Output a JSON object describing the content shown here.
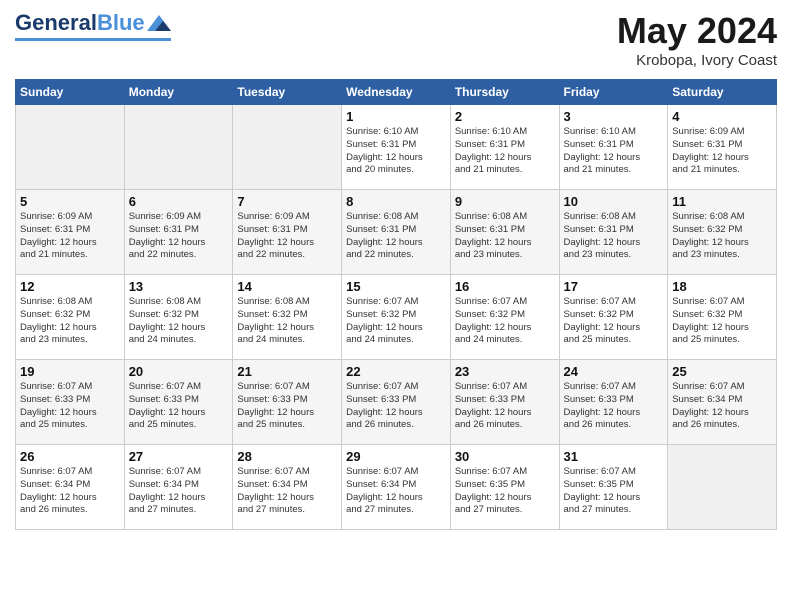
{
  "header": {
    "logo_line1": "General",
    "logo_line2": "Blue",
    "month": "May 2024",
    "location": "Krobopa, Ivory Coast"
  },
  "weekdays": [
    "Sunday",
    "Monday",
    "Tuesday",
    "Wednesday",
    "Thursday",
    "Friday",
    "Saturday"
  ],
  "weeks": [
    [
      {
        "day": "",
        "info": ""
      },
      {
        "day": "",
        "info": ""
      },
      {
        "day": "",
        "info": ""
      },
      {
        "day": "1",
        "info": "Sunrise: 6:10 AM\nSunset: 6:31 PM\nDaylight: 12 hours\nand 20 minutes."
      },
      {
        "day": "2",
        "info": "Sunrise: 6:10 AM\nSunset: 6:31 PM\nDaylight: 12 hours\nand 21 minutes."
      },
      {
        "day": "3",
        "info": "Sunrise: 6:10 AM\nSunset: 6:31 PM\nDaylight: 12 hours\nand 21 minutes."
      },
      {
        "day": "4",
        "info": "Sunrise: 6:09 AM\nSunset: 6:31 PM\nDaylight: 12 hours\nand 21 minutes."
      }
    ],
    [
      {
        "day": "5",
        "info": "Sunrise: 6:09 AM\nSunset: 6:31 PM\nDaylight: 12 hours\nand 21 minutes."
      },
      {
        "day": "6",
        "info": "Sunrise: 6:09 AM\nSunset: 6:31 PM\nDaylight: 12 hours\nand 22 minutes."
      },
      {
        "day": "7",
        "info": "Sunrise: 6:09 AM\nSunset: 6:31 PM\nDaylight: 12 hours\nand 22 minutes."
      },
      {
        "day": "8",
        "info": "Sunrise: 6:08 AM\nSunset: 6:31 PM\nDaylight: 12 hours\nand 22 minutes."
      },
      {
        "day": "9",
        "info": "Sunrise: 6:08 AM\nSunset: 6:31 PM\nDaylight: 12 hours\nand 23 minutes."
      },
      {
        "day": "10",
        "info": "Sunrise: 6:08 AM\nSunset: 6:31 PM\nDaylight: 12 hours\nand 23 minutes."
      },
      {
        "day": "11",
        "info": "Sunrise: 6:08 AM\nSunset: 6:32 PM\nDaylight: 12 hours\nand 23 minutes."
      }
    ],
    [
      {
        "day": "12",
        "info": "Sunrise: 6:08 AM\nSunset: 6:32 PM\nDaylight: 12 hours\nand 23 minutes."
      },
      {
        "day": "13",
        "info": "Sunrise: 6:08 AM\nSunset: 6:32 PM\nDaylight: 12 hours\nand 24 minutes."
      },
      {
        "day": "14",
        "info": "Sunrise: 6:08 AM\nSunset: 6:32 PM\nDaylight: 12 hours\nand 24 minutes."
      },
      {
        "day": "15",
        "info": "Sunrise: 6:07 AM\nSunset: 6:32 PM\nDaylight: 12 hours\nand 24 minutes."
      },
      {
        "day": "16",
        "info": "Sunrise: 6:07 AM\nSunset: 6:32 PM\nDaylight: 12 hours\nand 24 minutes."
      },
      {
        "day": "17",
        "info": "Sunrise: 6:07 AM\nSunset: 6:32 PM\nDaylight: 12 hours\nand 25 minutes."
      },
      {
        "day": "18",
        "info": "Sunrise: 6:07 AM\nSunset: 6:32 PM\nDaylight: 12 hours\nand 25 minutes."
      }
    ],
    [
      {
        "day": "19",
        "info": "Sunrise: 6:07 AM\nSunset: 6:33 PM\nDaylight: 12 hours\nand 25 minutes."
      },
      {
        "day": "20",
        "info": "Sunrise: 6:07 AM\nSunset: 6:33 PM\nDaylight: 12 hours\nand 25 minutes."
      },
      {
        "day": "21",
        "info": "Sunrise: 6:07 AM\nSunset: 6:33 PM\nDaylight: 12 hours\nand 25 minutes."
      },
      {
        "day": "22",
        "info": "Sunrise: 6:07 AM\nSunset: 6:33 PM\nDaylight: 12 hours\nand 26 minutes."
      },
      {
        "day": "23",
        "info": "Sunrise: 6:07 AM\nSunset: 6:33 PM\nDaylight: 12 hours\nand 26 minutes."
      },
      {
        "day": "24",
        "info": "Sunrise: 6:07 AM\nSunset: 6:33 PM\nDaylight: 12 hours\nand 26 minutes."
      },
      {
        "day": "25",
        "info": "Sunrise: 6:07 AM\nSunset: 6:34 PM\nDaylight: 12 hours\nand 26 minutes."
      }
    ],
    [
      {
        "day": "26",
        "info": "Sunrise: 6:07 AM\nSunset: 6:34 PM\nDaylight: 12 hours\nand 26 minutes."
      },
      {
        "day": "27",
        "info": "Sunrise: 6:07 AM\nSunset: 6:34 PM\nDaylight: 12 hours\nand 27 minutes."
      },
      {
        "day": "28",
        "info": "Sunrise: 6:07 AM\nSunset: 6:34 PM\nDaylight: 12 hours\nand 27 minutes."
      },
      {
        "day": "29",
        "info": "Sunrise: 6:07 AM\nSunset: 6:34 PM\nDaylight: 12 hours\nand 27 minutes."
      },
      {
        "day": "30",
        "info": "Sunrise: 6:07 AM\nSunset: 6:35 PM\nDaylight: 12 hours\nand 27 minutes."
      },
      {
        "day": "31",
        "info": "Sunrise: 6:07 AM\nSunset: 6:35 PM\nDaylight: 12 hours\nand 27 minutes."
      },
      {
        "day": "",
        "info": ""
      }
    ]
  ]
}
